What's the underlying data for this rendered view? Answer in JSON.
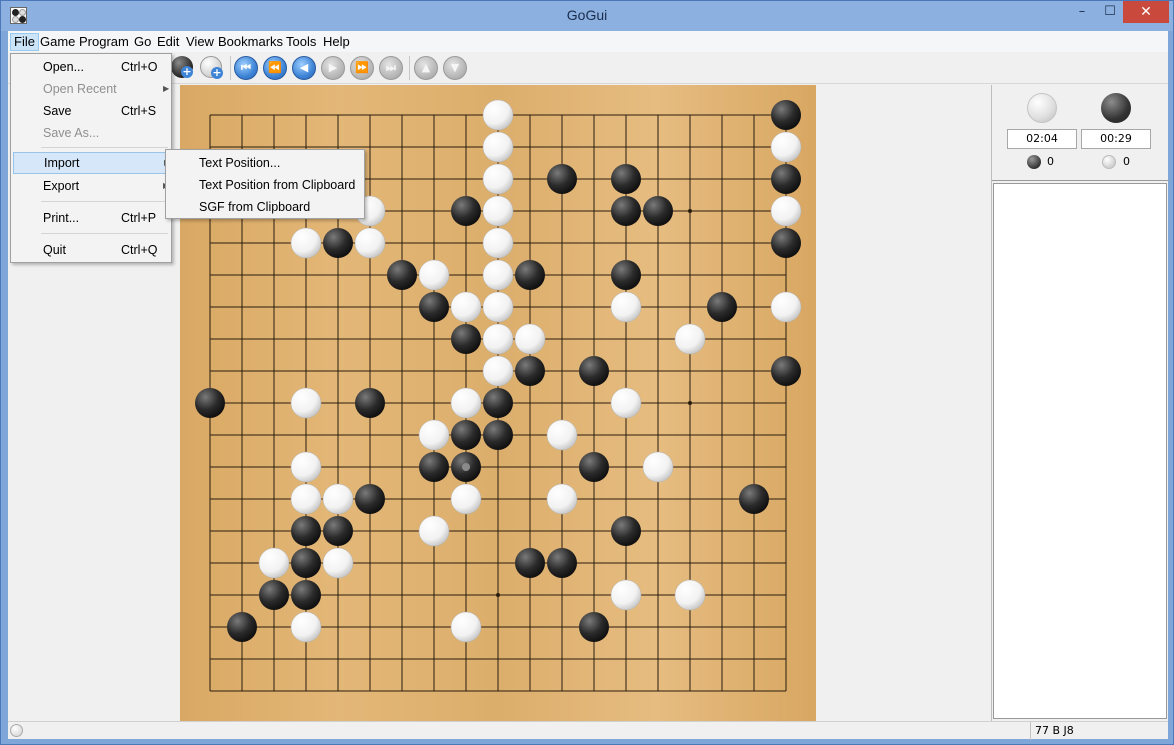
{
  "window": {
    "title": "GoGui",
    "controls": {
      "minimize": "–",
      "maximize": "☐",
      "close": "✕"
    }
  },
  "menubar": [
    "File",
    "Game",
    "Program",
    "Go",
    "Edit",
    "View",
    "Bookmarks",
    "Tools",
    "Help"
  ],
  "active_menu": "File",
  "file_menu": {
    "items": [
      {
        "label": "Open...",
        "shortcut": "Ctrl+O",
        "enabled": true
      },
      {
        "label": "Open Recent",
        "shortcut": "",
        "enabled": false,
        "submenu": true
      },
      {
        "label": "Save",
        "shortcut": "Ctrl+S",
        "enabled": true
      },
      {
        "label": "Save As...",
        "shortcut": "",
        "enabled": false
      },
      {
        "label": "Import",
        "shortcut": "",
        "enabled": true,
        "submenu": true,
        "highlighted": true
      },
      {
        "label": "Export",
        "shortcut": "",
        "enabled": true,
        "submenu": true
      },
      {
        "label": "Print...",
        "shortcut": "Ctrl+P",
        "enabled": true
      },
      {
        "label": "Quit",
        "shortcut": "Ctrl+Q",
        "enabled": true
      }
    ]
  },
  "import_submenu": [
    "Text Position...",
    "Text Position from Clipboard",
    "SGF from Clipboard"
  ],
  "toolbar": {
    "icons": [
      "black-stone-setup-icon",
      "white-stone-setup-icon",
      "beginning-icon",
      "backward-10-icon",
      "backward-icon",
      "forward-icon",
      "forward-10-icon",
      "end-icon",
      "previous-variation-icon",
      "next-variation-icon"
    ],
    "glyphs": {
      "beginning": "⏮",
      "backward10": "⏪",
      "backward": "◀",
      "forward": "▶",
      "forward10": "⏩",
      "end": "⏭",
      "up": "▲",
      "down": "▼",
      "plus": "+"
    }
  },
  "board": {
    "size": 19,
    "star_points": [
      [
        3,
        3
      ],
      [
        3,
        9
      ],
      [
        3,
        15
      ],
      [
        9,
        3
      ],
      [
        9,
        9
      ],
      [
        9,
        15
      ],
      [
        15,
        3
      ],
      [
        15,
        9
      ],
      [
        15,
        15
      ]
    ],
    "black": [
      [
        18,
        0
      ],
      [
        11,
        2
      ],
      [
        13,
        2
      ],
      [
        18,
        2
      ],
      [
        8,
        3
      ],
      [
        13,
        3
      ],
      [
        14,
        3
      ],
      [
        4,
        4
      ],
      [
        18,
        4
      ],
      [
        6,
        5
      ],
      [
        10,
        5
      ],
      [
        13,
        5
      ],
      [
        7,
        6
      ],
      [
        16,
        6
      ],
      [
        8,
        7
      ],
      [
        10,
        8
      ],
      [
        12,
        8
      ],
      [
        18,
        8
      ],
      [
        0,
        9
      ],
      [
        5,
        9
      ],
      [
        9,
        9
      ],
      [
        8,
        10
      ],
      [
        9,
        10
      ],
      [
        7,
        11
      ],
      [
        8,
        11
      ],
      [
        12,
        11
      ],
      [
        17,
        12
      ],
      [
        5,
        12
      ],
      [
        3,
        13
      ],
      [
        4,
        13
      ],
      [
        13,
        13
      ],
      [
        3,
        14
      ],
      [
        10,
        14
      ],
      [
        11,
        14
      ],
      [
        2,
        15
      ],
      [
        3,
        15
      ],
      [
        1,
        16
      ],
      [
        12,
        16
      ]
    ],
    "white": [
      [
        9,
        0
      ],
      [
        9,
        1
      ],
      [
        18,
        1
      ],
      [
        9,
        2
      ],
      [
        9,
        3
      ],
      [
        5,
        3
      ],
      [
        18,
        3
      ],
      [
        3,
        4
      ],
      [
        5,
        4
      ],
      [
        9,
        4
      ],
      [
        7,
        5
      ],
      [
        9,
        5
      ],
      [
        8,
        6
      ],
      [
        9,
        6
      ],
      [
        13,
        6
      ],
      [
        18,
        6
      ],
      [
        9,
        7
      ],
      [
        10,
        7
      ],
      [
        15,
        7
      ],
      [
        9,
        8
      ],
      [
        3,
        9
      ],
      [
        8,
        9
      ],
      [
        13,
        9
      ],
      [
        7,
        10
      ],
      [
        11,
        10
      ],
      [
        3,
        11
      ],
      [
        14,
        11
      ],
      [
        3,
        12
      ],
      [
        4,
        12
      ],
      [
        8,
        12
      ],
      [
        11,
        12
      ],
      [
        7,
        13
      ],
      [
        2,
        14
      ],
      [
        4,
        14
      ],
      [
        13,
        15
      ],
      [
        15,
        15
      ],
      [
        3,
        16
      ],
      [
        8,
        16
      ]
    ],
    "last_move": [
      8,
      11
    ],
    "colors": {
      "board": "#dcae6c",
      "line": "#2a1d0e",
      "black_stone": "#2b2b2b",
      "white_stone": "#f2f2f2"
    }
  },
  "clocks": {
    "white": "02:04",
    "black": "00:29"
  },
  "captures": {
    "black": "0",
    "white": "0"
  },
  "status": {
    "text": "77 B J8"
  }
}
